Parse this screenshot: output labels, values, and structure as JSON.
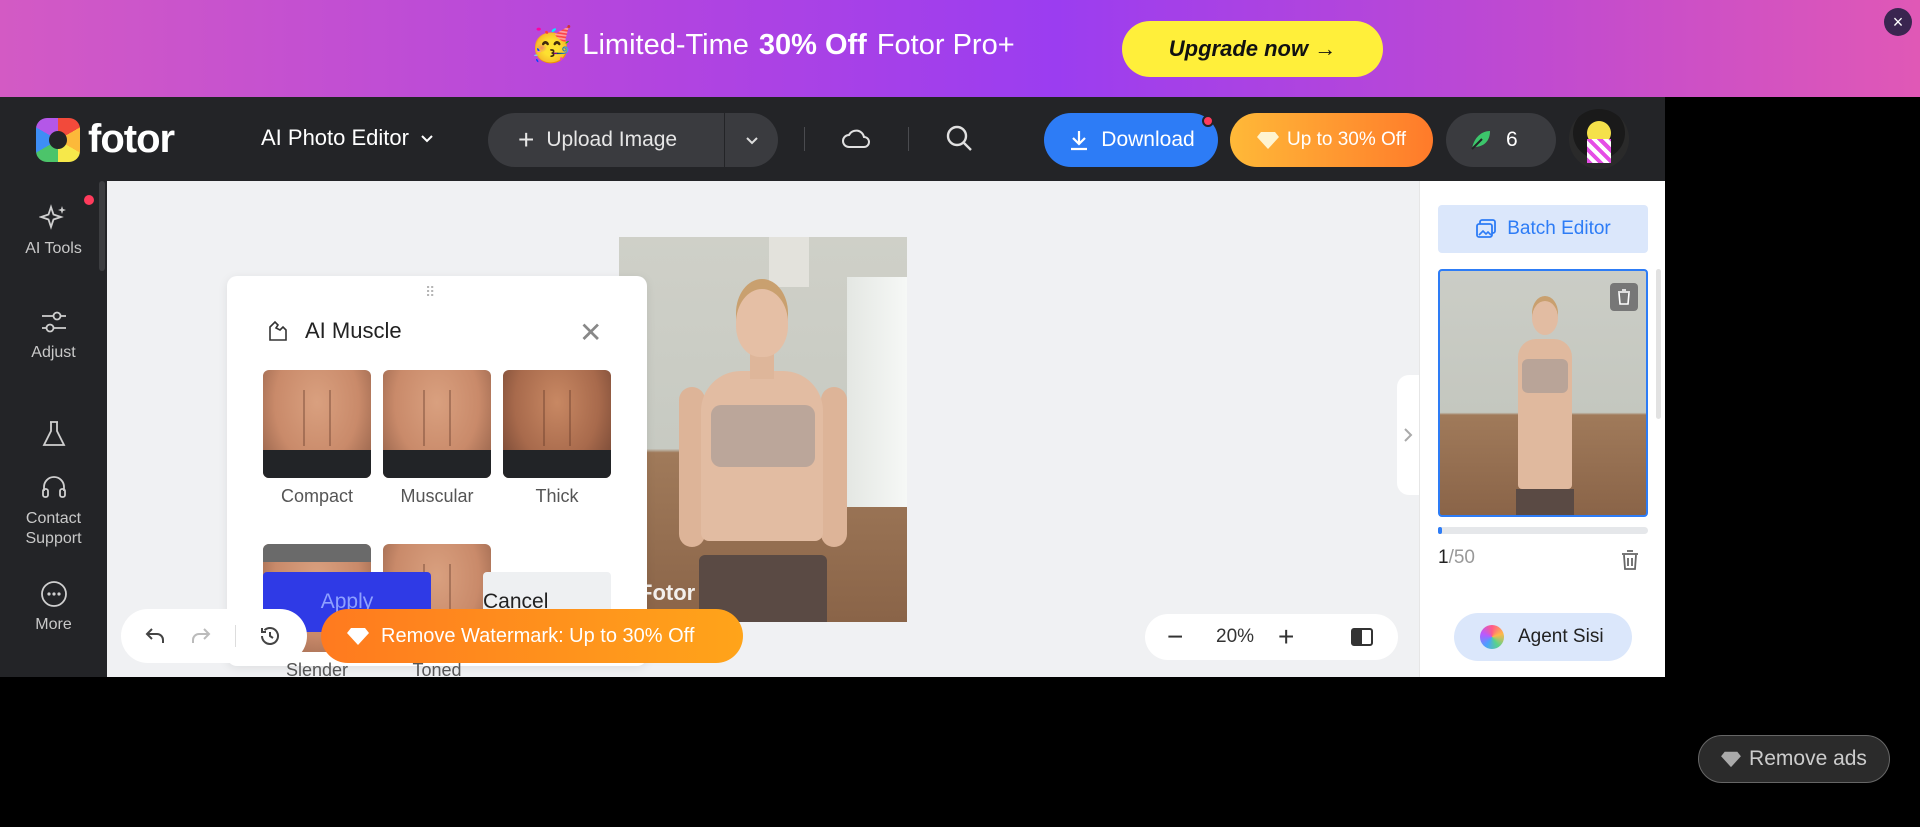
{
  "promo": {
    "emoji": "🥳",
    "text_before": "Limited-Time",
    "text_bold": "30% Off",
    "text_after": "Fotor Pro+",
    "cta": "Upgrade now →",
    "close": "×"
  },
  "header": {
    "logo_text": "fotor",
    "editor_label": "AI Photo Editor",
    "upload_label": "Upload Image",
    "download_label": "Download",
    "offer_label": "Up to 30% Off",
    "credits": "6"
  },
  "sidebar": {
    "items": [
      {
        "label": "AI Tools",
        "icon": "sparkles-icon"
      },
      {
        "label": "Adjust",
        "icon": "sliders-icon"
      },
      {
        "label": "",
        "icon": "flask-icon"
      },
      {
        "label": "Contact Support",
        "icon": "headset-icon"
      },
      {
        "label": "More",
        "icon": "more-icon"
      }
    ]
  },
  "panel": {
    "title": "AI Muscle",
    "styles": [
      "Compact",
      "Muscular",
      "Thick",
      "Slender",
      "Toned"
    ],
    "apply_label": "Apply",
    "cancel_label": "Cancel"
  },
  "canvas": {
    "watermark": "Fotor",
    "remove_watermark_label": "Remove Watermark: Up to 30% Off",
    "zoom": "20%"
  },
  "right_panel": {
    "batch_label": "Batch Editor",
    "page_current": "1",
    "page_total": "/50",
    "agent_label": "Agent Sisi"
  },
  "remove_ads_label": "Remove ads",
  "colors": {
    "accent": "#2d7cf6",
    "apply": "#2f3ae6",
    "orange": "#ff8a1f",
    "upgrade": "#ffef3a"
  }
}
